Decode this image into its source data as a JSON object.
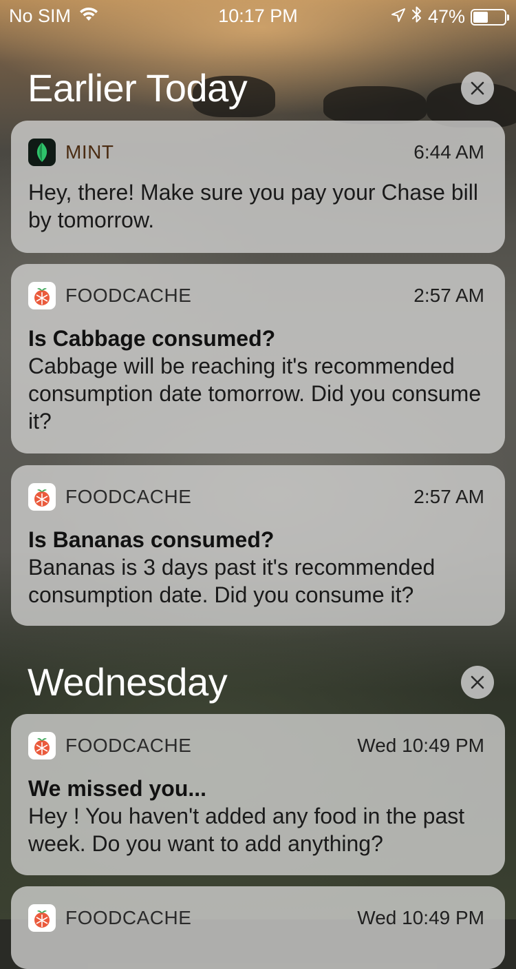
{
  "status_bar": {
    "carrier": "No SIM",
    "time": "10:17 PM",
    "battery_percent": "47%",
    "battery_level": 0.47,
    "icons": [
      "wifi-icon",
      "location-arrow-icon",
      "bluetooth-icon",
      "battery-icon"
    ]
  },
  "sections": [
    {
      "title": "Earlier Today",
      "clear_icon": "close-icon",
      "notifications": [
        {
          "app": "MINT",
          "icon": "mint-leaf-icon",
          "time": "6:44 AM",
          "title": "",
          "body": "Hey, there! Make sure you pay your Chase bill by tomorrow."
        },
        {
          "app": "FOODCACHE",
          "icon": "foodcache-tomato-icon",
          "time": "2:57 AM",
          "title": "Is Cabbage consumed?",
          "body": "Cabbage will be reaching it's recommended consumption date tomorrow. Did you consume it?"
        },
        {
          "app": "FOODCACHE",
          "icon": "foodcache-tomato-icon",
          "time": "2:57 AM",
          "title": "Is Bananas consumed?",
          "body": "Bananas is 3 days past it's recommended consumption date. Did you consume it?"
        }
      ]
    },
    {
      "title": "Wednesday",
      "clear_icon": "close-icon",
      "notifications": [
        {
          "app": "FOODCACHE",
          "icon": "foodcache-tomato-icon",
          "time": "Wed 10:49 PM",
          "title": "We missed you...",
          "body": "Hey ! You haven't added any food in the past week. Do you want to add anything?"
        },
        {
          "app": "FOODCACHE",
          "icon": "foodcache-tomato-icon",
          "time": "Wed 10:49 PM",
          "title": "",
          "body": ""
        }
      ]
    }
  ],
  "colors": {
    "card_background": "#d0d0ce",
    "foodcache_brand": "#ea5a3c",
    "mint_brand": "#2ec26a"
  }
}
